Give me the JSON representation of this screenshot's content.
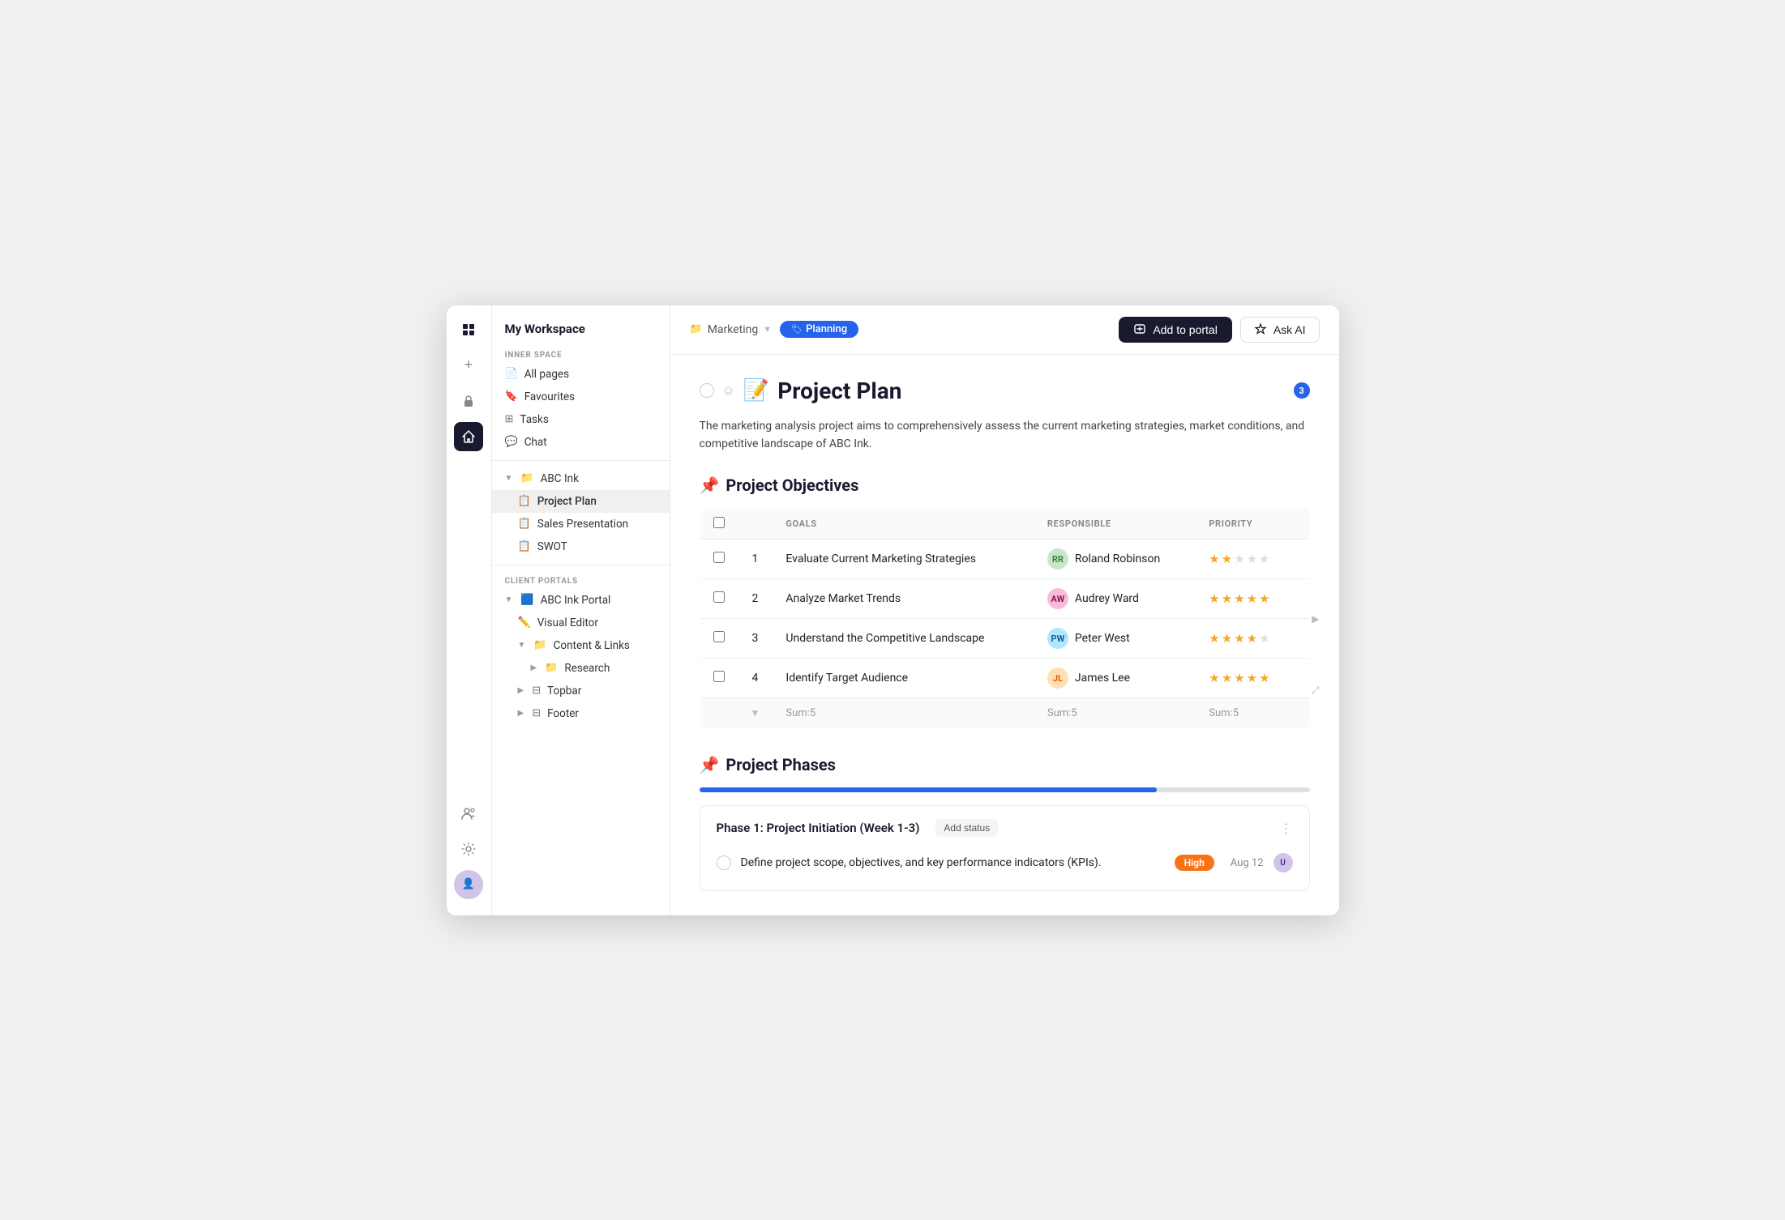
{
  "workspace": {
    "title": "My Workspace"
  },
  "innerspace": {
    "label": "INNER SPACE",
    "items": [
      {
        "id": "all-pages",
        "icon": "📄",
        "label": "All pages"
      },
      {
        "id": "favourites",
        "icon": "🔖",
        "label": "Favourites"
      },
      {
        "id": "tasks",
        "icon": "⊞",
        "label": "Tasks"
      },
      {
        "id": "chat",
        "icon": "💬",
        "label": "Chat"
      }
    ]
  },
  "abc_ink": {
    "label": "ABC Ink",
    "items": [
      {
        "id": "project-plan",
        "icon": "📝",
        "label": "Project Plan",
        "active": true
      },
      {
        "id": "sales-presentation",
        "icon": "📋",
        "label": "Sales Presentation"
      },
      {
        "id": "swot",
        "icon": "📋",
        "label": "SWOT"
      }
    ]
  },
  "client_portals": {
    "label": "CLIENT PORTALS",
    "portal_name": "ABC Ink Portal",
    "items": [
      {
        "id": "visual-editor",
        "icon": "✏️",
        "label": "Visual Editor"
      },
      {
        "id": "content-links",
        "icon": "📁",
        "label": "Content & Links"
      },
      {
        "id": "research",
        "icon": "📁",
        "label": "Research"
      },
      {
        "id": "topbar",
        "icon": "⊟",
        "label": "Topbar"
      },
      {
        "id": "footer",
        "icon": "⊟",
        "label": "Footer"
      }
    ]
  },
  "header": {
    "breadcrumb_icon": "📁",
    "breadcrumb_label": "Marketing",
    "tag_icon": "🏷",
    "tag_label": "Planning",
    "btn_add_portal": "Add to portal",
    "btn_ask_ai": "Ask AI"
  },
  "page": {
    "title_emoji": "📝",
    "title": "Project Plan",
    "notification_count": "3",
    "description": "The marketing analysis project aims to comprehensively assess the current marketing strategies, market conditions, and competitive landscape of ABC Ink.",
    "objectives_title_emoji": "📌",
    "objectives_title": "Project Objectives",
    "objectives_columns": [
      "GOALS",
      "RESPONSIBLE",
      "PRIORITY"
    ],
    "objectives_rows": [
      {
        "num": "1",
        "goal": "Evaluate Current Marketing Strategies",
        "responsible": "Roland Robinson",
        "avatar_initials": "RR",
        "avatar_class": "av-roland",
        "stars": [
          true,
          true,
          false,
          false,
          false
        ]
      },
      {
        "num": "2",
        "goal": "Analyze Market Trends",
        "responsible": "Audrey Ward",
        "avatar_initials": "AW",
        "avatar_class": "av-audrey",
        "stars": [
          true,
          true,
          true,
          true,
          true
        ]
      },
      {
        "num": "3",
        "goal": "Understand the Competitive Landscape",
        "responsible": "Peter West",
        "avatar_initials": "PW",
        "avatar_class": "av-peter",
        "stars": [
          true,
          true,
          true,
          true,
          false
        ]
      },
      {
        "num": "4",
        "goal": "Identify Target Audience",
        "responsible": "James Lee",
        "avatar_initials": "JL",
        "avatar_class": "av-james",
        "stars": [
          true,
          true,
          true,
          true,
          true
        ]
      }
    ],
    "sum_label": "Sum:5",
    "phases_title_emoji": "📌",
    "phases_title": "Project Phases",
    "phase_progress": 75,
    "phase1_title": "Phase 1: Project Initiation (Week 1-3)",
    "phase1_add_status": "Add status",
    "phase1_task": "Define project scope, objectives, and key performance indicators (KPIs).",
    "phase1_priority": "High",
    "phase1_date": "Aug 12",
    "phase1_avatar_initials": "U",
    "phase1_avatar_class": "av-user"
  }
}
